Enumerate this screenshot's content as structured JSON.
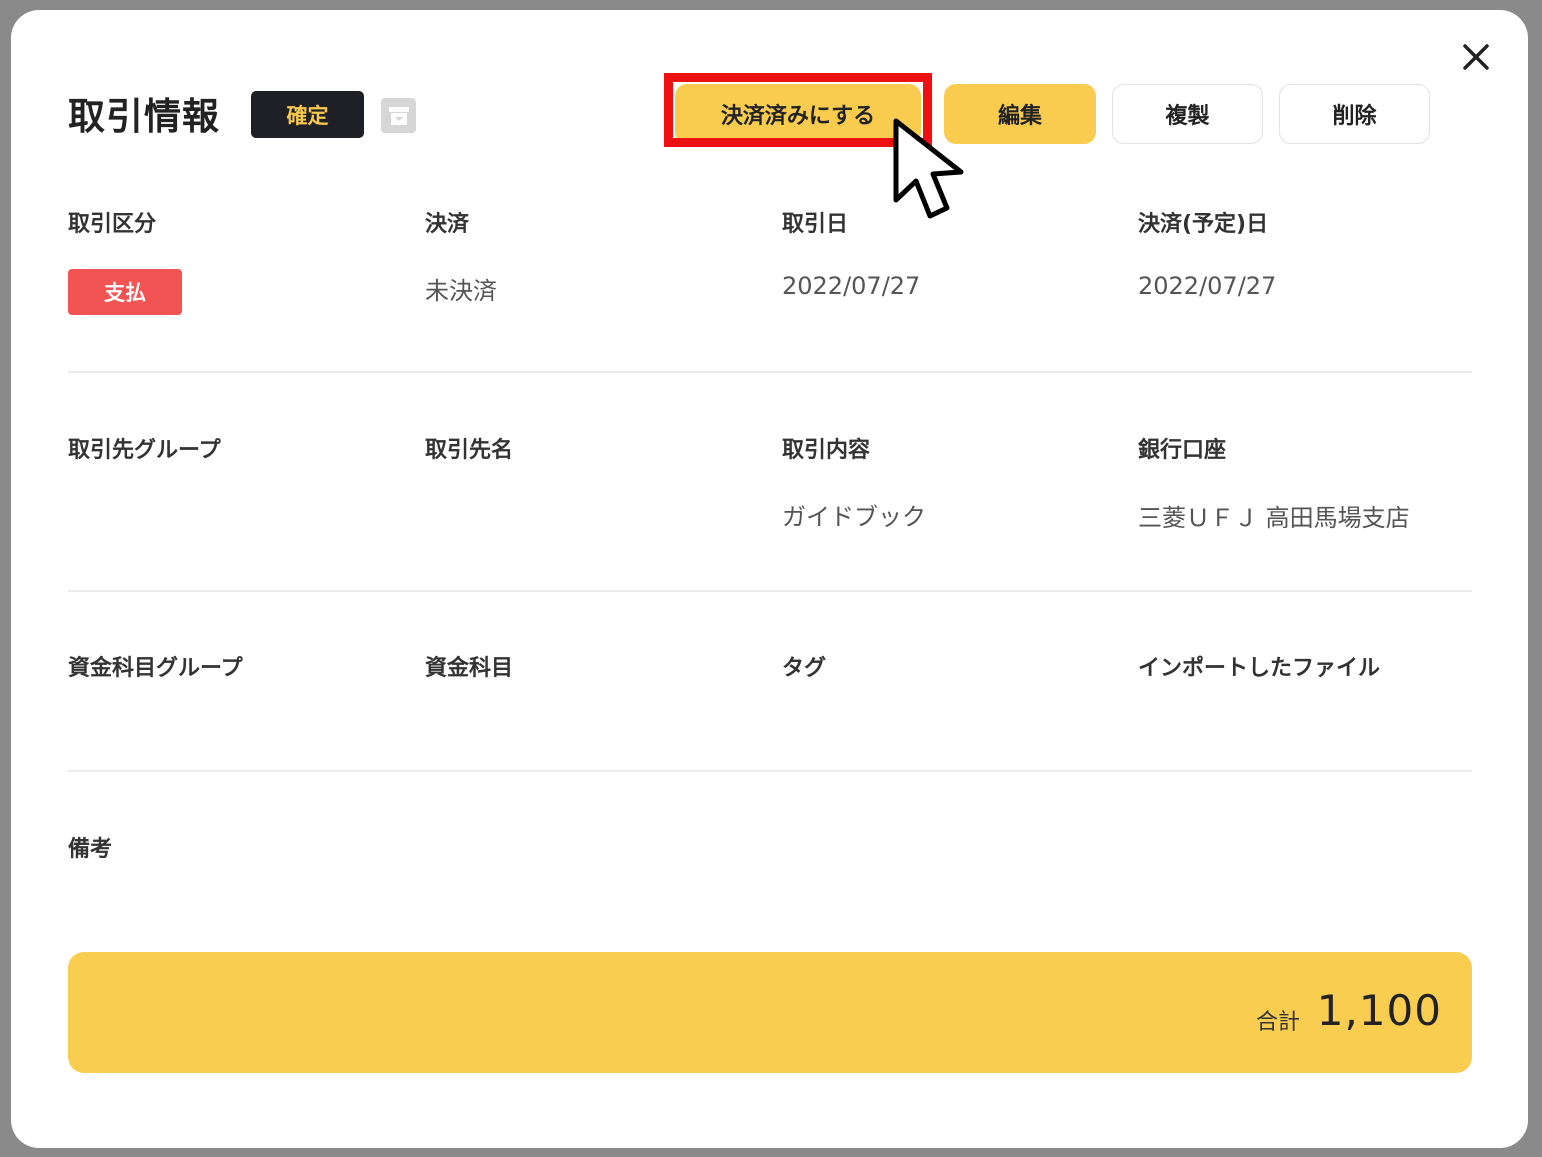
{
  "header": {
    "title": "取引情報",
    "status": "確定",
    "close": "✕"
  },
  "actions": {
    "settle": "決済済みにする",
    "edit": "編集",
    "duplicate": "複製",
    "delete": "削除"
  },
  "fields": {
    "type_label": "取引区分",
    "type_value": "支払",
    "settlement_label": "決済",
    "settlement_value": "未決済",
    "date_label": "取引日",
    "date_value": "2022/07/27",
    "settle_date_label": "決済(予定)日",
    "settle_date_value": "2022/07/27",
    "partner_group_label": "取引先グループ",
    "partner_name_label": "取引先名",
    "content_label": "取引内容",
    "content_value": "ガイドブック",
    "bank_label": "銀行口座",
    "bank_value": "三菱ＵＦＪ 高田馬場支店",
    "account_group_label": "資金科目グループ",
    "account_label": "資金科目",
    "tag_label": "タグ",
    "import_label": "インポートしたファイル",
    "notes_label": "備考"
  },
  "total": {
    "label": "合計",
    "value": "1,100"
  },
  "colors": {
    "accent_yellow": "#f9cc50",
    "badge_dark": "#1f1f26",
    "payment_red": "#f25353",
    "highlight_red": "#ee1111"
  },
  "icons": {
    "close": "close-icon",
    "archive": "archive-icon",
    "cursor": "mouse-pointer-icon"
  }
}
